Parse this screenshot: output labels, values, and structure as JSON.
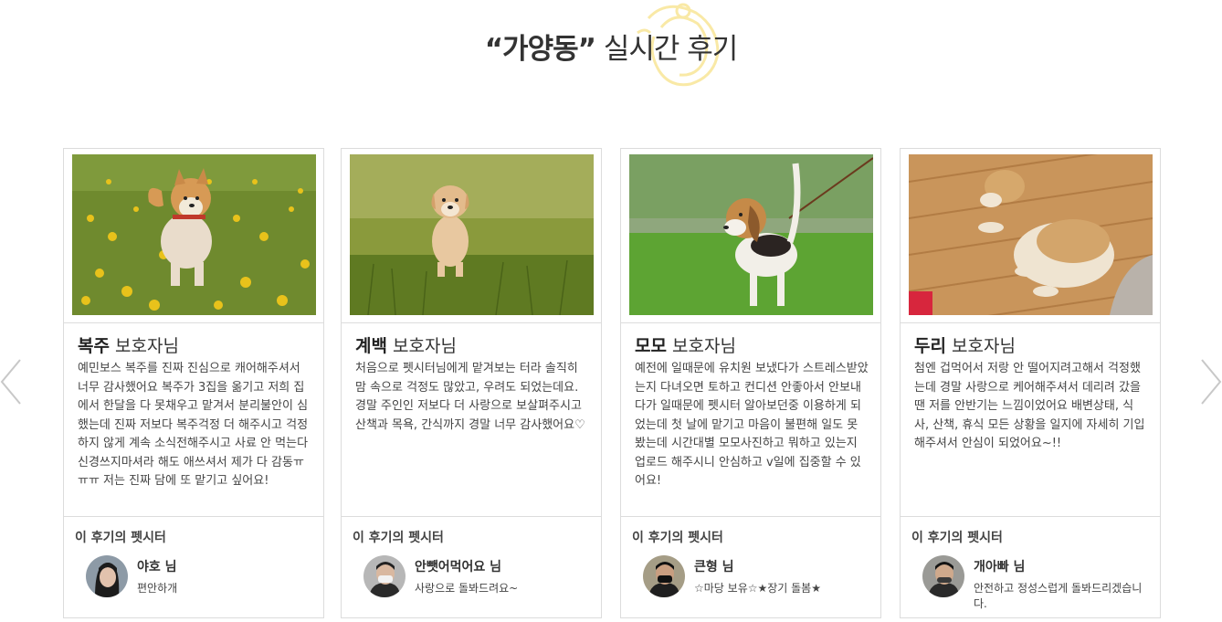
{
  "header": {
    "title_bold": "“가양동”",
    "title_rest": " 실시간 후기"
  },
  "foot_title": "이 후기의 펫시터",
  "cards": [
    {
      "dog_name": "복주",
      "suffix": " 보호자님",
      "review": "예민보스 복주를 진짜 진심으로 캐어해주셔서 너무 감사했어요 복주가 3집을 옮기고 저희 집에서 한달을 다 못채우고 맡겨서 분리불안이 심했는데 진짜 저보다 복주걱정 더 해주시고 걱정하지 않게 계속 소식전해주시고 사료 안 먹는다 신경쓰지마셔라 해도 애쓰셔서 제가 다 감동ㅠㅠㅠ 저는 진짜 담에 또 맡기고 싶어요!",
      "sitter_name": "야호 님",
      "sitter_desc": "편안하개"
    },
    {
      "dog_name": "계백",
      "suffix": " 보호자님",
      "review": "처음으로 펫시터님에게 맡겨보는 터라 솔직히 맘 속으로 걱정도 많았고, 우려도 되었는데요. 경말 주인인 저보다 더 사랑으로 보살펴주시고 산책과 목욕, 간식까지 경말 너무 감사했어요♡",
      "sitter_name": "안뺏어먹어요 님",
      "sitter_desc": "사랑으로 돌봐드려요~"
    },
    {
      "dog_name": "모모",
      "suffix": " 보호자님",
      "review": "예전에 일때문에 유치원 보냈다가 스트레스받았는지 다녀오면 토하고 컨디션 안좋아서 안보내다가 일때문에 펫시터 알아보던중 이용하게 되었는데 첫 날에 맡기고 마음이 불편해 일도 못봤는데 시간대별 모모사진하고 뭐하고 있는지 업로드 해주시니 안심하고 v일에 집중할 수 있어요!",
      "sitter_name": "큰형 님",
      "sitter_desc": "☆마당 보유☆★장기 돌봄★"
    },
    {
      "dog_name": "두리",
      "suffix": " 보호자님",
      "review": "첨엔 겁먹어서 저랑 안 떨어지려고해서 걱정했는데 경말 사랑으로 케어해주셔서 데리려 갔을 땐 저를 안반기는 느낌이었어요 배변상태, 식사, 산책, 휴식 모든 상황을 일지에 자세히 기입해주셔서 안심이 되었어요~!!",
      "sitter_name": "개아빠 님",
      "sitter_desc": "안전하고 정성스럽게 돌봐드리겠습니다."
    }
  ]
}
